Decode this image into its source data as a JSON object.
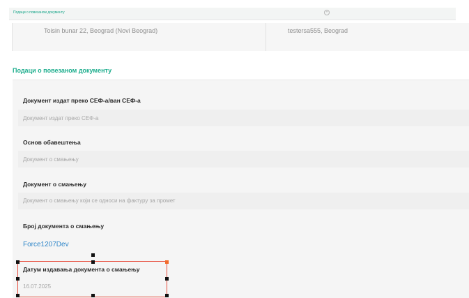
{
  "topbar": {
    "title": "Подаци о повезаном документу",
    "icon": "circle-plus-icon"
  },
  "address": {
    "left": "Toisin bunar 22, Beograd (Novi Beograd)",
    "right": "testersa555, Beograd"
  },
  "section": {
    "title": "Подаци о повезаном документу"
  },
  "fields": [
    {
      "label": "Документ издат преко СЕФ-а/ван СЕФ-а",
      "value": "Документ издат преко СЕФ-а"
    },
    {
      "label": "Основ обавештења",
      "value": "Документ о смањењу"
    },
    {
      "label": "Документ о смањењу",
      "value": "Документ о смањењу који се односи на фактуру за промет"
    },
    {
      "label": "Број документа о смањењу",
      "value": "Force1207Dev"
    },
    {
      "label": "Датум издавања документа о смањењу",
      "value": "16.07.2025"
    }
  ],
  "colors": {
    "accent": "#1fae8e",
    "link": "#2f86c9",
    "selection": "#e74c3c"
  }
}
